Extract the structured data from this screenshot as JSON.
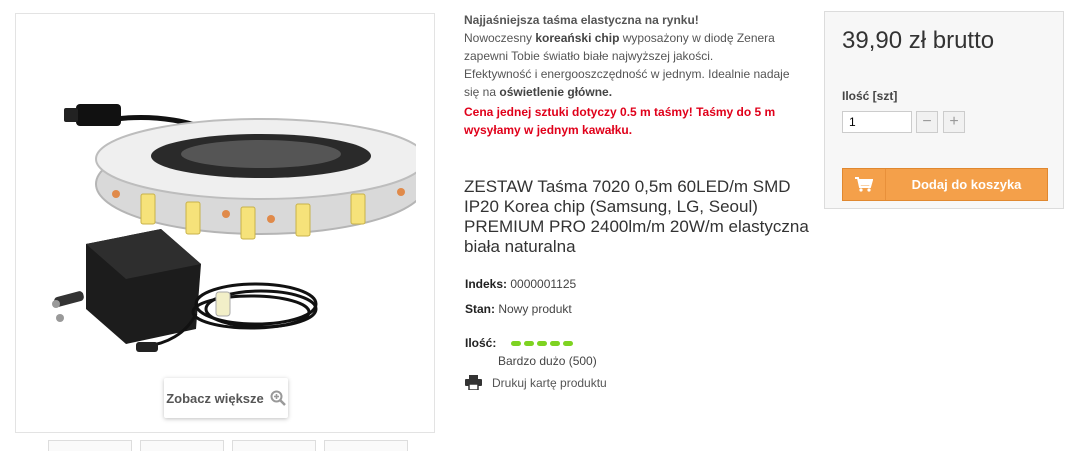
{
  "gallery": {
    "zoom_label": "Zobacz większe"
  },
  "description": {
    "intro": "Najjaśniejsza taśma elastyczna na rynku!",
    "line2_pre": "Nowoczesny ",
    "line2_bold": "koreański chip",
    "line2_post": " wyposażony w diodę Zenera zapewni Tobie światło białe najwyższej jakości.",
    "line3_pre": "Efektywność i energooszczędność w jednym. Idealnie nadaje się na ",
    "line3_bold": "oświetlenie główne.",
    "note": "Cena jednej sztuki dotyczy 0.5 m taśmy! Taśmy do 5 m wysyłamy w jednym kawałku."
  },
  "product": {
    "title": "ZESTAW Taśma 7020 0,5m 60LED/m SMD IP20 Korea chip (Samsung, LG, Seoul) PREMIUM PRO 2400lm/m 20W/m elastyczna biała naturalna",
    "index_label": "Indeks:",
    "index_value": "0000001125",
    "state_label": "Stan:",
    "state_value": "Nowy produkt",
    "qty_label": "Ilość:",
    "qty_value": "Bardzo dużo (500)",
    "stock_level": 1.0,
    "print_label": "Drukuj kartę produktu"
  },
  "buybox": {
    "price": "39,90 zł brutto",
    "qty_label": "Ilość [szt]",
    "qty_value": "1",
    "minus": "−",
    "plus": "+",
    "add_label": "Dodaj do koszyka"
  },
  "colors": {
    "accent": "#f4a04a",
    "note": "#e0001a",
    "stock": "#7ed321"
  }
}
